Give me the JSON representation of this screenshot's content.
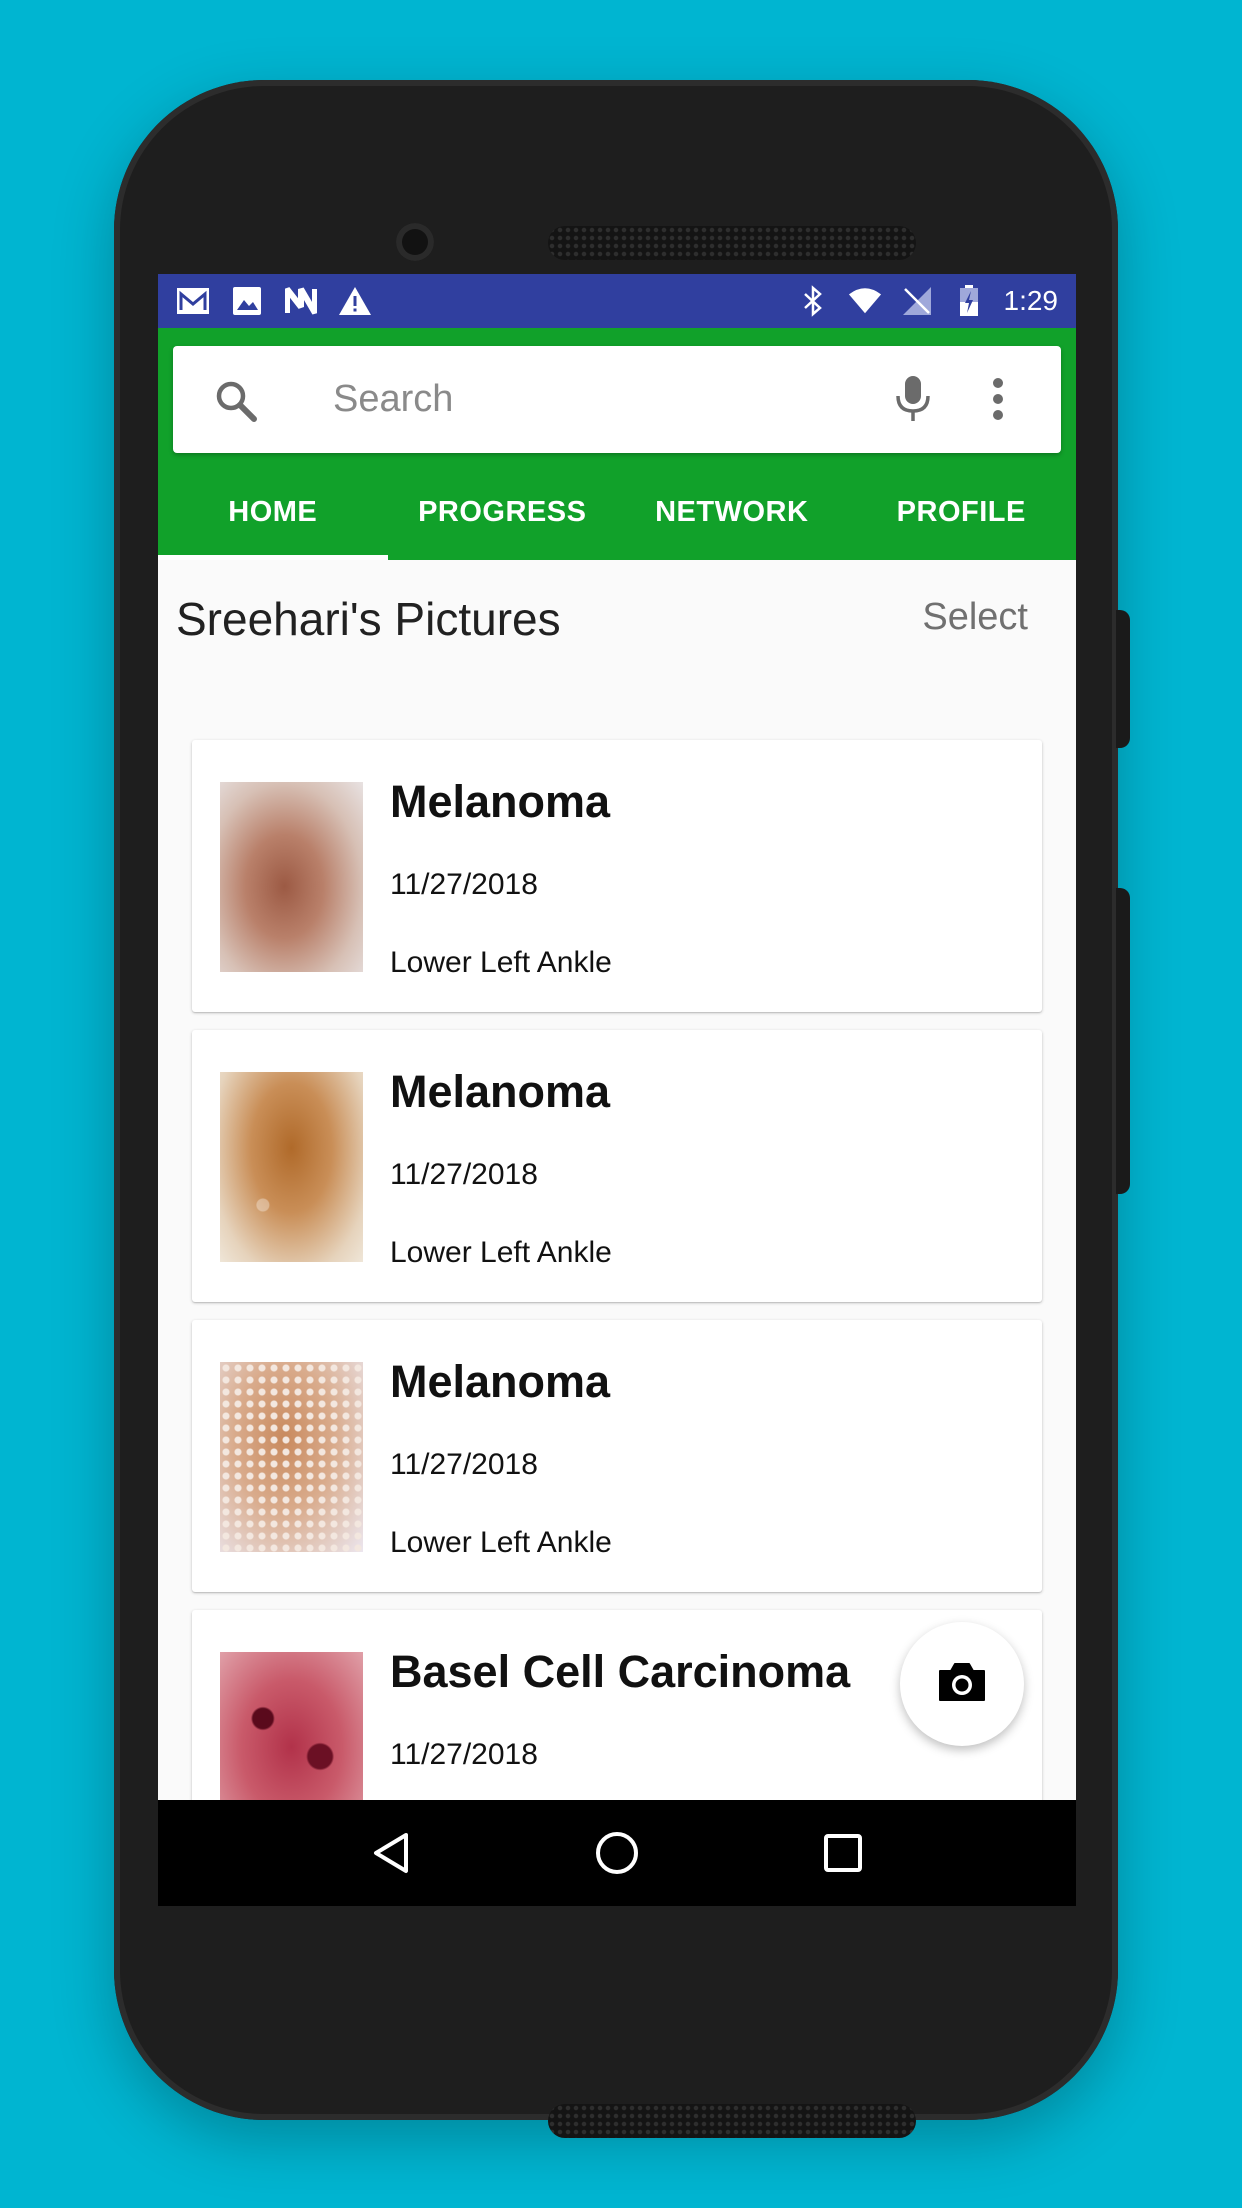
{
  "status_bar": {
    "time": "1:29",
    "left_icons": [
      "gmail-icon",
      "image-icon",
      "n-icon",
      "warning-icon"
    ],
    "right_icons": [
      "bluetooth-icon",
      "wifi-icon",
      "no-sim-icon",
      "battery-charging-icon"
    ],
    "color": "#303f9f"
  },
  "app_bar": {
    "color": "#11a12a",
    "search": {
      "placeholder": "Search",
      "value": ""
    },
    "tabs": [
      {
        "label": "HOME",
        "active": true
      },
      {
        "label": "PROGRESS",
        "active": false
      },
      {
        "label": "NETWORK",
        "active": false
      },
      {
        "label": "PROFILE",
        "active": false
      }
    ]
  },
  "main": {
    "title": "Sreehari's Pictures",
    "select_label": "Select",
    "items": [
      {
        "title": "Melanoma",
        "date": "11/27/2018",
        "location": "Lower Left Ankle"
      },
      {
        "title": "Melanoma",
        "date": "11/27/2018",
        "location": "Lower Left Ankle"
      },
      {
        "title": "Melanoma",
        "date": "11/27/2018",
        "location": "Lower Left Ankle"
      },
      {
        "title": "Basel Cell Carcinoma",
        "date": "11/27/2018",
        "location": ""
      }
    ]
  },
  "fab": {
    "icon": "camera-icon"
  },
  "nav_bar": {
    "buttons": [
      "back-icon",
      "home-icon",
      "recents-icon"
    ]
  }
}
